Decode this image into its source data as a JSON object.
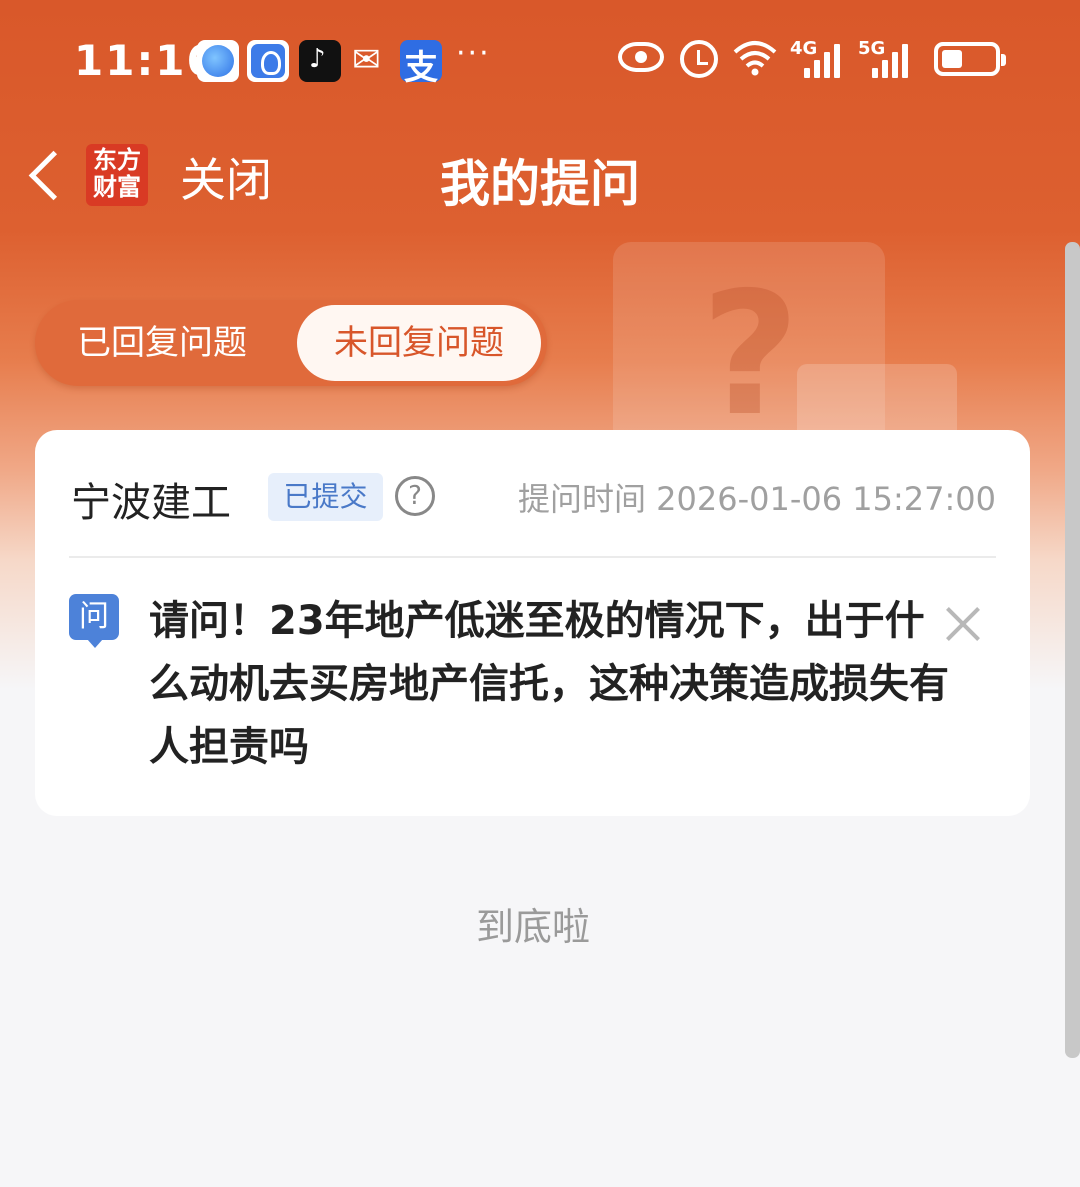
{
  "status_bar": {
    "time": "11:16",
    "app_icons": [
      "browser-icon",
      "lightbulb-app-icon",
      "tiktok-icon",
      "wechat-icon",
      "alipay-icon"
    ],
    "tiktok_glyph": "♪",
    "wechat_glyph": "✉",
    "alipay_glyph": "支",
    "more": "···",
    "signal_1_label": "4G",
    "signal_2_label": "5G"
  },
  "nav": {
    "back_icon": "chevron-left-icon",
    "logo_line1": "东方",
    "logo_line2": "财富",
    "close_label": "关闭",
    "title": "我的提问"
  },
  "tabs": [
    {
      "label": "已回复问题",
      "active": false
    },
    {
      "label": "未回复问题",
      "active": true
    }
  ],
  "card": {
    "company": "宁波建工",
    "status_badge": "已提交",
    "help_glyph": "?",
    "ask_time": "提问时间 2026-01-06 15:27:00",
    "question_icon_label": "问",
    "question": "请问！23年地产低迷至极的情况下，出于什么动机去买房地产信托，这种决策造成损失有人担责吗"
  },
  "footer_text": "到底啦",
  "colors": {
    "header_orange": "#d9582a",
    "active_tab_text": "#d8562a",
    "badge_bg": "#e7effb",
    "badge_text": "#4a79c8",
    "question_icon": "#4d82d9"
  }
}
